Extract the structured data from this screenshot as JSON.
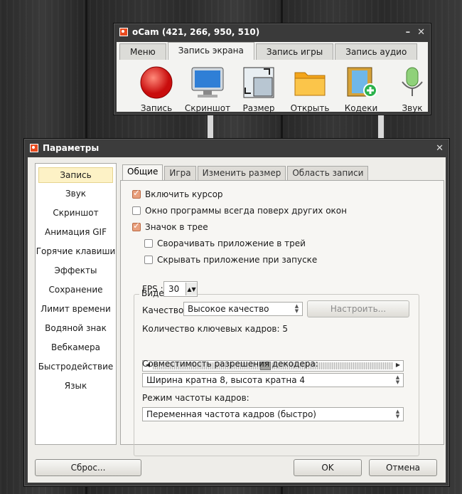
{
  "ocam": {
    "title": "oCam (421, 266, 950, 510)",
    "tabs": [
      "Меню",
      "Запись экрана",
      "Запись игры",
      "Запись аудио"
    ],
    "tools": [
      "Запись",
      "Скриншот",
      "Размер",
      "Открыть",
      "Кодеки",
      "Звук"
    ]
  },
  "dialog": {
    "title": "Параметры",
    "left_items": [
      "Запись",
      "Звук",
      "Скриншот",
      "Анимация GIF",
      "Горячие клавиши",
      "Эффекты",
      "Сохранение",
      "Лимит времени",
      "Водяной знак",
      "Вебкамера",
      "Быстродействие",
      "Язык"
    ],
    "tabs": [
      "Общие",
      "Игра",
      "Изменить размер",
      "Область записи"
    ],
    "checks": [
      {
        "label": "Включить курсор",
        "checked": true
      },
      {
        "label": "Окно программы всегда поверх других окон",
        "checked": false
      },
      {
        "label": "Значок в трее",
        "checked": true
      },
      {
        "label": "Сворачивать приложение в трей",
        "checked": false
      },
      {
        "label": "Скрывать приложение при запуске",
        "checked": false
      }
    ],
    "video_group": "Видео",
    "fps_label": "FPS :",
    "fps_value": "30",
    "quality_label": "Качество:",
    "quality_value": "Высокое качество",
    "configure_button": "Настроить...",
    "keyframes_label": "Количество ключевых кадров: 5",
    "keyframes_value": 5,
    "decoder_label": "Совместимость разрешения декодера:",
    "decoder_value": "Ширина кратна 8, высота кратна 4",
    "framerate_label": "Режим частоты кадров:",
    "framerate_value": "Переменная частота кадров (быстро)",
    "reset_button": "Сброс...",
    "ok_button": "OK",
    "cancel_button": "Отмена"
  }
}
